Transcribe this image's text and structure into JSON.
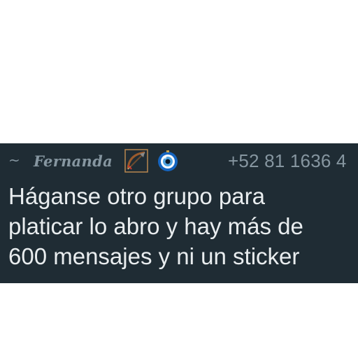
{
  "message": {
    "sender_prefix": "~",
    "sender_name": "Fernanda",
    "sender_emojis": [
      "bow-and-arrow-icon",
      "nazar-amulet-icon"
    ],
    "phone": "+52 81 1636 4",
    "text_lines": [
      "Háganse otro grupo para",
      "platicar lo abro y hay más de",
      "600 mensajes y ni un sticker"
    ]
  },
  "colors": {
    "bubble_bg": "#1f2c34",
    "meta_text": "#8696a0",
    "body_text": "#e9edef",
    "page_bg": "#ffffff"
  }
}
